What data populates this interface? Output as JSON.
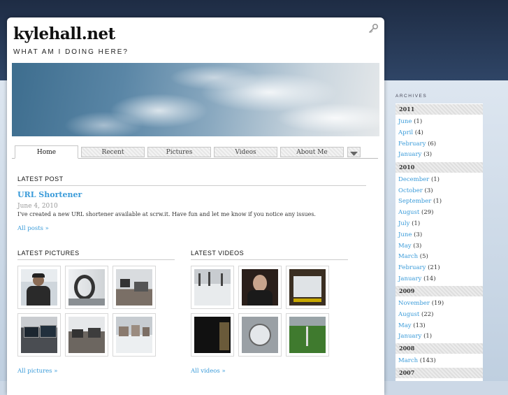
{
  "site": {
    "title": "kylehall.net",
    "tagline": "WHAT AM I DOING HERE?"
  },
  "nav": {
    "tabs": [
      {
        "label": "Home",
        "active": true
      },
      {
        "label": "Recent"
      },
      {
        "label": "Pictures"
      },
      {
        "label": "Videos"
      },
      {
        "label": "About Me"
      }
    ]
  },
  "latest_post": {
    "heading": "LATEST POST",
    "title": "URL Shortener",
    "date": "June 4, 2010",
    "body": "I've created a new URL shortener available at scrw.it. Have fun and let me know if you notice any issues.",
    "all_link": "All posts »"
  },
  "latest_pictures": {
    "heading": "LATEST PICTURES",
    "all_link": "All pictures »"
  },
  "latest_videos": {
    "heading": "LATEST VIDEOS",
    "all_link": "All videos »"
  },
  "archives": {
    "title": "ARCHIVES",
    "years": [
      {
        "year": "2011",
        "months": [
          {
            "name": "June",
            "count": "(1)"
          },
          {
            "name": "April",
            "count": "(4)"
          },
          {
            "name": "February",
            "count": "(6)"
          },
          {
            "name": "January",
            "count": "(3)"
          }
        ]
      },
      {
        "year": "2010",
        "months": [
          {
            "name": "December",
            "count": "(1)"
          },
          {
            "name": "October",
            "count": "(3)"
          },
          {
            "name": "September",
            "count": "(1)"
          },
          {
            "name": "August",
            "count": "(29)"
          },
          {
            "name": "July",
            "count": "(1)"
          },
          {
            "name": "June",
            "count": "(3)"
          },
          {
            "name": "May",
            "count": "(3)"
          },
          {
            "name": "March",
            "count": "(5)"
          },
          {
            "name": "February",
            "count": "(21)"
          },
          {
            "name": "January",
            "count": "(14)"
          }
        ]
      },
      {
        "year": "2009",
        "months": [
          {
            "name": "November",
            "count": "(19)"
          },
          {
            "name": "August",
            "count": "(22)"
          },
          {
            "name": "May",
            "count": "(13)"
          },
          {
            "name": "January",
            "count": "(1)"
          }
        ]
      },
      {
        "year": "2008",
        "months": [
          {
            "name": "March",
            "count": "(143)"
          }
        ]
      },
      {
        "year": "2007",
        "months": []
      }
    ]
  },
  "colors": {
    "link": "#3a9bd9",
    "header_bg": "#1e2c44"
  }
}
